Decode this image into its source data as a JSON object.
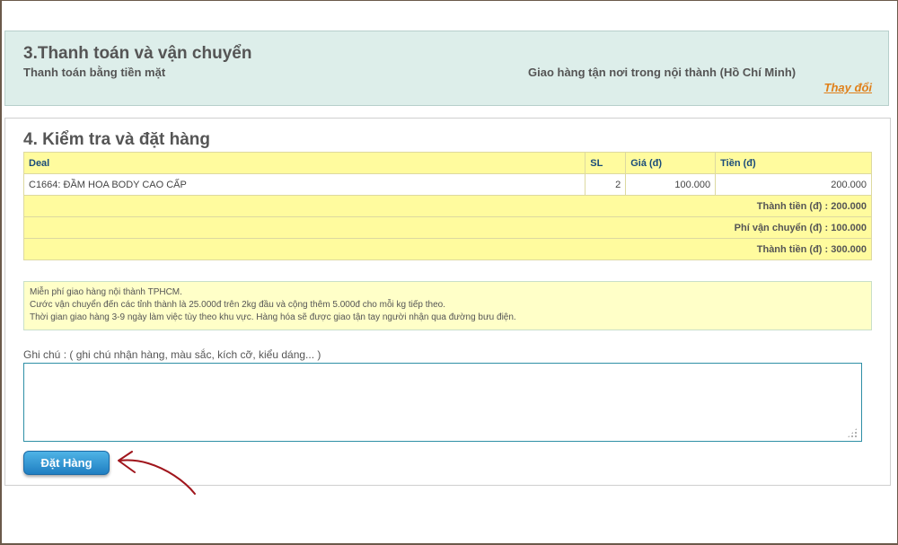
{
  "section3": {
    "title": "3.Thanh toán và vận chuyển",
    "payment_method": "Thanh toán bằng tiền mặt",
    "shipping_method": "Giao hàng tận nơi trong nội thành (Hồ Chí Minh)",
    "change_link": "Thay đổi"
  },
  "section4": {
    "title": "4. Kiểm tra và đặt hàng",
    "table": {
      "headers": [
        "Deal",
        "SL",
        "Giá (đ)",
        "Tiền (đ)"
      ],
      "rows": [
        {
          "deal": "C1664: ĐẦM HOA BODY CAO CẤP",
          "qty": "2",
          "price": "100.000",
          "amount": "200.000"
        }
      ],
      "subtotal": "Thành tiền (đ) : 200.000",
      "shipping_fee": "Phí vận chuyển (đ) : 100.000",
      "total": "Thành tiền (đ) : 300.000"
    },
    "note_lines": [
      "Miễn phí giao hàng nội thành TPHCM.",
      "Cước vận chuyển đến các tỉnh thành là 25.000đ trên 2kg đầu và cộng thêm 5.000đ cho mỗi kg tiếp theo.",
      "Thời gian giao hàng 3-9 ngày làm việc tùy theo khu vực. Hàng hóa sẽ được giao tận tay người nhận qua đường bưu điện."
    ],
    "comment_label": "Ghi chú : ( ghi chú nhận hàng, màu sắc, kích cỡ, kiểu dáng... )",
    "comment_value": "",
    "order_button": "Đặt Hàng"
  },
  "colors": {
    "section3_bg": "#ddeeea",
    "table_header_bg": "#fffb9e",
    "link_orange": "#e0801a",
    "button_blue": "#1f7fc2",
    "annotation_arrow": "#a0151c"
  },
  "icons": [
    "resize-grip-icon",
    "annotation-arrow-icon"
  ]
}
